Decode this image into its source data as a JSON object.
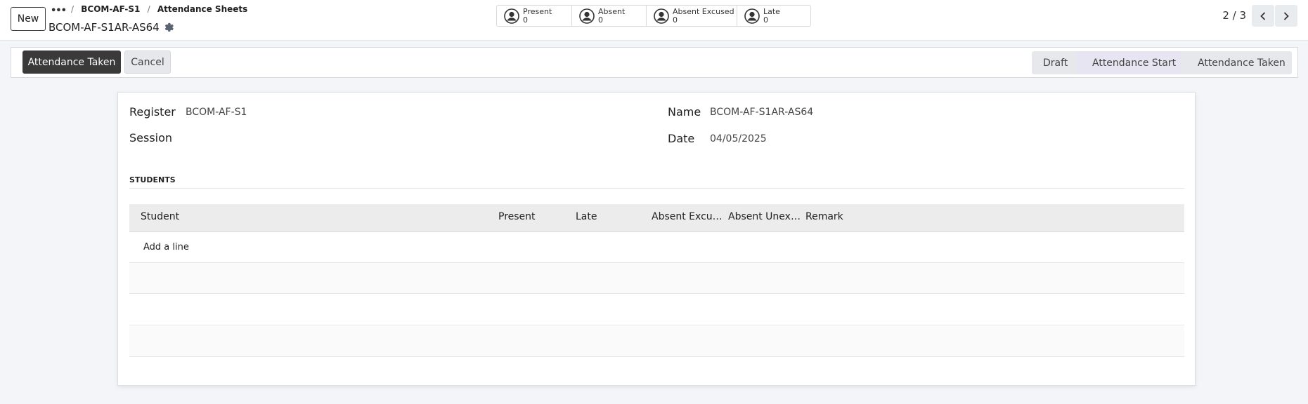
{
  "topbar": {
    "new_label": "New",
    "breadcrumb": [
      "BCOM-AF-S1",
      "Attendance Sheets"
    ],
    "breadcrumb_sep": "/",
    "record_title": "BCOM-AF-S1AR-AS64",
    "stats": [
      {
        "label": "Present",
        "value": "0"
      },
      {
        "label": "Absent",
        "value": "0"
      },
      {
        "label": "Absent Excused",
        "value": "0"
      },
      {
        "label": "Late",
        "value": "0"
      }
    ],
    "pager": "2 / 3"
  },
  "actions": {
    "primary_label": "Attendance Taken",
    "cancel_label": "Cancel",
    "stages": [
      "Draft",
      "Attendance Start",
      "Attendance Taken"
    ],
    "active_stage": "Attendance Start"
  },
  "form": {
    "register_label": "Register",
    "register_value": "BCOM-AF-S1",
    "session_label": "Session",
    "session_value": "",
    "name_label": "Name",
    "name_value": "BCOM-AF-S1AR-AS64",
    "date_label": "Date",
    "date_value": "04/05/2025",
    "section_title": "STUDENTS",
    "columns": [
      "Student",
      "Present",
      "Late",
      "Absent Excu…",
      "Absent Unex…",
      "Remark"
    ],
    "add_line_label": "Add a line"
  },
  "colors": {
    "primary_button": "#3a3a3a",
    "active_stage": "#e7e5f2",
    "background": "#f3f5f8"
  }
}
